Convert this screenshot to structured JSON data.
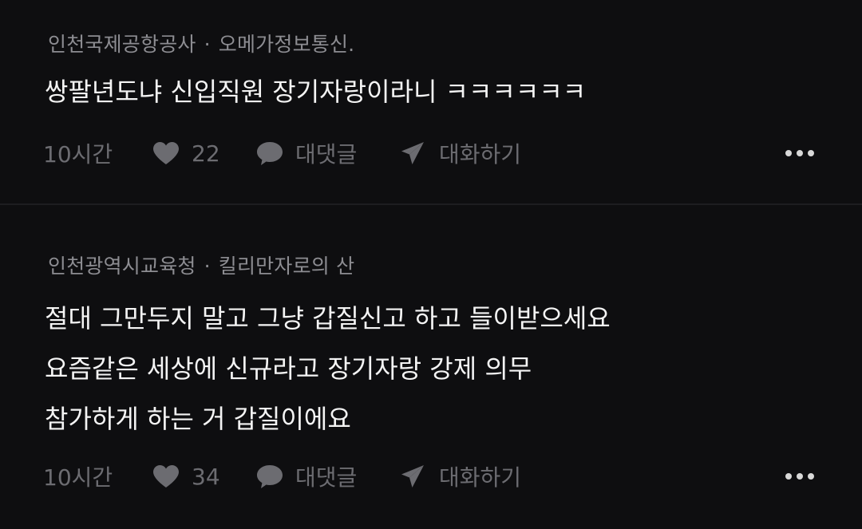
{
  "comments": [
    {
      "organization": "인천국제공항공사",
      "separator": "·",
      "username": "오메가정보통신.",
      "lines": [
        "쌍팔년도냐 신입직원 장기자랑이라니 ㅋㅋㅋㅋㅋㅋ"
      ],
      "time": "10시간",
      "likes": "22",
      "reply_label": "대댓글",
      "conversation_label": "대화하기"
    },
    {
      "organization": "인천광역시교육청",
      "separator": "·",
      "username": "킬리만자로의 산",
      "lines": [
        "절대 그만두지 말고 그냥 갑질신고 하고 들이받으세요",
        "요즘같은 세상에 신규라고 장기자랑 강제 의무",
        "참가하게 하는 거 갑질이에요"
      ],
      "time": "10시간",
      "likes": "34",
      "reply_label": "대댓글",
      "conversation_label": "대화하기"
    }
  ],
  "colors": {
    "background": "#0e0e10",
    "text": "#f4f4f4",
    "meta": "#8d8d92",
    "action": "#6c6c71"
  },
  "icons": {
    "like": "heart-icon",
    "reply": "speech-bubble-icon",
    "conversation": "paper-plane-icon",
    "more": "more-dots-icon"
  }
}
